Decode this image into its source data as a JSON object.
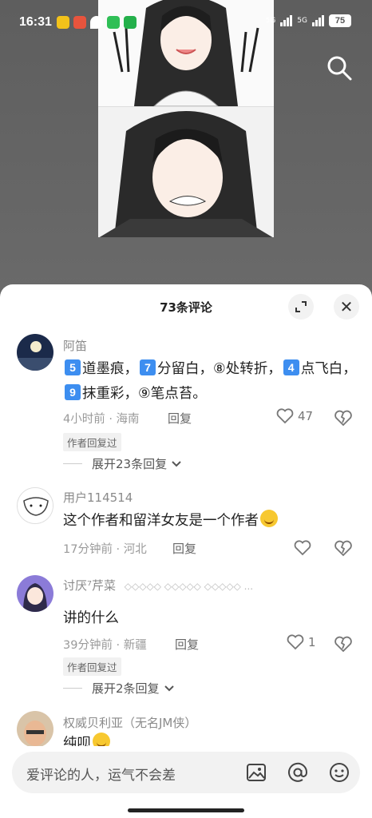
{
  "status_bar": {
    "time": "16:31",
    "signal_1_label": "5G",
    "signal_2_label": "5G",
    "battery": "75"
  },
  "comments_panel": {
    "title": "73条评论",
    "comments": [
      {
        "username": "阿笛",
        "text_parts": [
          "5",
          "道墨痕，",
          "7",
          "分留白，⑧处转折，",
          "4",
          "点飞白，",
          "9",
          "抹重彩，⑨笔点苔。"
        ],
        "meta": "4小时前 · 海南",
        "reply_label": "回复",
        "likes": "47",
        "badge": "作者回复过",
        "expand_label": "展开23条回复"
      },
      {
        "username": "用户114514",
        "text": "这个作者和留洋女友是一个作者",
        "meta": "17分钟前 · 河北",
        "reply_label": "回复"
      },
      {
        "username": "讨厌⁷芹菜",
        "username_suffix": "◇◇◇◇◇ ◇◇◇◇◇ ◇◇◇◇◇ ...",
        "text": "讲的什么",
        "meta": "39分钟前 · 新疆",
        "reply_label": "回复",
        "likes": "1",
        "badge": "作者回复过",
        "expand_label": "展开2条回复"
      },
      {
        "username": "权威贝利亚（无名JM侠）",
        "text": "纯呗"
      }
    ]
  },
  "input_bar": {
    "placeholder": "爱评论的人，运气不会差"
  },
  "colors": {
    "accent_blue": "#3d8ef0",
    "sheet_bg": "#ffffff",
    "backdrop": "#6b6b6b"
  }
}
